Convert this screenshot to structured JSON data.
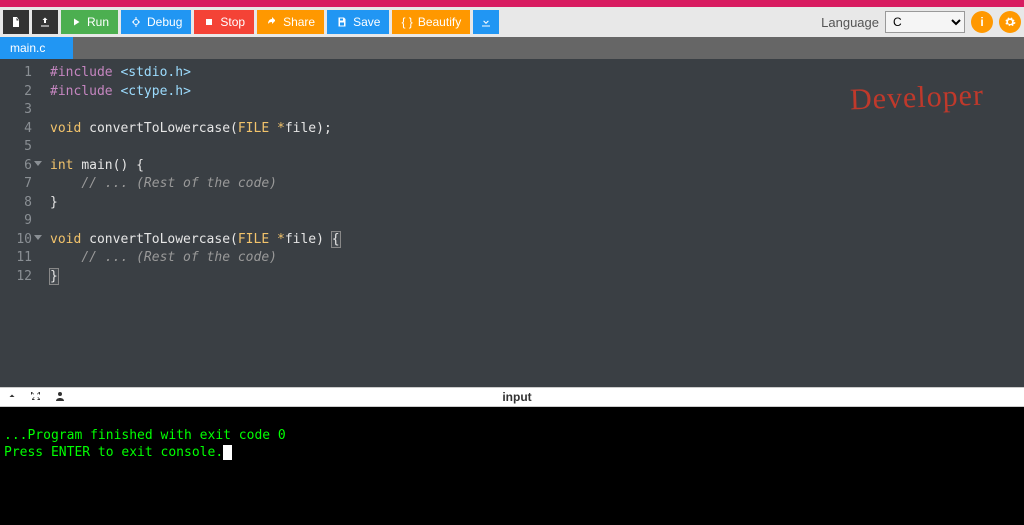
{
  "toolbar": {
    "new_label": "",
    "open_label": "",
    "run_label": "Run",
    "debug_label": "Debug",
    "stop_label": "Stop",
    "share_label": "Share",
    "save_label": "Save",
    "beautify_label": "Beautify",
    "download_label": ""
  },
  "language": {
    "label": "Language",
    "selected": "C"
  },
  "tabs": [
    {
      "label": "main.c"
    }
  ],
  "code": {
    "lines": [
      {
        "n": 1,
        "fold": false,
        "tokens": [
          [
            "pp",
            "#include "
          ],
          [
            "inc",
            "<stdio.h>"
          ]
        ]
      },
      {
        "n": 2,
        "fold": false,
        "tokens": [
          [
            "pp",
            "#include "
          ],
          [
            "inc",
            "<ctype.h>"
          ]
        ]
      },
      {
        "n": 3,
        "fold": false,
        "tokens": []
      },
      {
        "n": 4,
        "fold": false,
        "tokens": [
          [
            "type",
            "void "
          ],
          [
            "fn",
            "convertToLowercase"
          ],
          [
            "punct",
            "("
          ],
          [
            "type",
            "FILE "
          ],
          [
            "op",
            "*"
          ],
          [
            "fn",
            "file"
          ],
          [
            "punct",
            ");"
          ]
        ]
      },
      {
        "n": 5,
        "fold": false,
        "tokens": []
      },
      {
        "n": 6,
        "fold": true,
        "tokens": [
          [
            "type",
            "int "
          ],
          [
            "fn",
            "main"
          ],
          [
            "punct",
            "() {"
          ]
        ]
      },
      {
        "n": 7,
        "fold": false,
        "tokens": [
          [
            "punct",
            "    "
          ],
          [
            "cmt",
            "// ... (Rest of the code)"
          ]
        ]
      },
      {
        "n": 8,
        "fold": false,
        "tokens": [
          [
            "punct",
            "}"
          ]
        ]
      },
      {
        "n": 9,
        "fold": false,
        "tokens": []
      },
      {
        "n": 10,
        "fold": true,
        "tokens": [
          [
            "type",
            "void "
          ],
          [
            "fn",
            "convertToLowercase"
          ],
          [
            "punct",
            "("
          ],
          [
            "type",
            "FILE "
          ],
          [
            "op",
            "*"
          ],
          [
            "fn",
            "file"
          ],
          [
            "punct",
            ") "
          ],
          [
            "brace",
            "{"
          ]
        ]
      },
      {
        "n": 11,
        "fold": false,
        "tokens": [
          [
            "punct",
            "    "
          ],
          [
            "cmt",
            "// ... (Rest of the code)"
          ]
        ]
      },
      {
        "n": 12,
        "fold": false,
        "tokens": [
          [
            "brace",
            "}"
          ]
        ]
      }
    ]
  },
  "watermark": "Developer",
  "console": {
    "tab_label": "input",
    "lines": [
      "...Program finished with exit code 0",
      "Press ENTER to exit console."
    ]
  }
}
